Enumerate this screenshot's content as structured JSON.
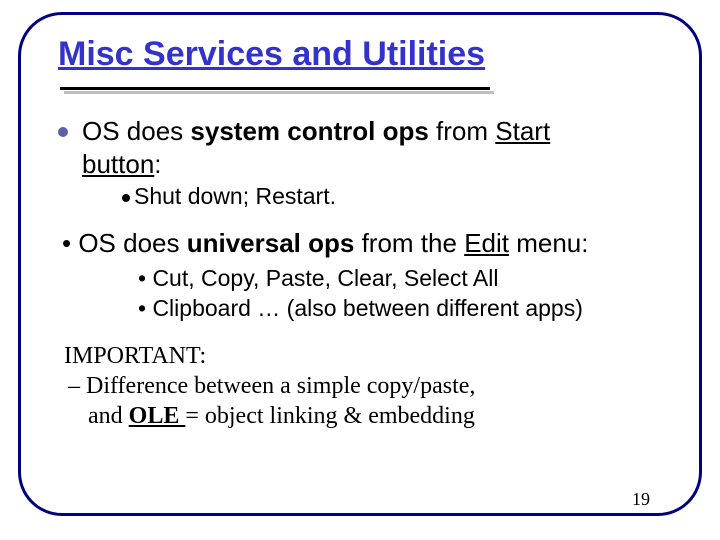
{
  "title": "Misc Services and Utilities",
  "b1_pre": "OS does ",
  "b1_bold": "system control ops",
  "b1_mid": " from ",
  "b1_start": "Start",
  "b1_btn_pre": " ",
  "b1_btn": "button",
  "b1_colon": ":",
  "b1_sub": "Shut down; Restart.",
  "b2_dot": "• ",
  "b2_pre": "OS does ",
  "b2_bold": "universal ops",
  "b2_mid": " from the ",
  "b2_edit": "Edit",
  "b2_menu": " menu",
  "b2_colon": ":",
  "b2_sub1": "• Cut, Copy, Paste, Clear, Select All",
  "b2_sub2": "• Clipboard …  (also between different apps)",
  "imp_label": "IMPORTANT:",
  "imp_line1": "–  Difference between a simple copy/paste,",
  "imp_and": "and ",
  "imp_ole": "OLE ",
  "imp_rest": " = object linking & embedding",
  "page": "19"
}
